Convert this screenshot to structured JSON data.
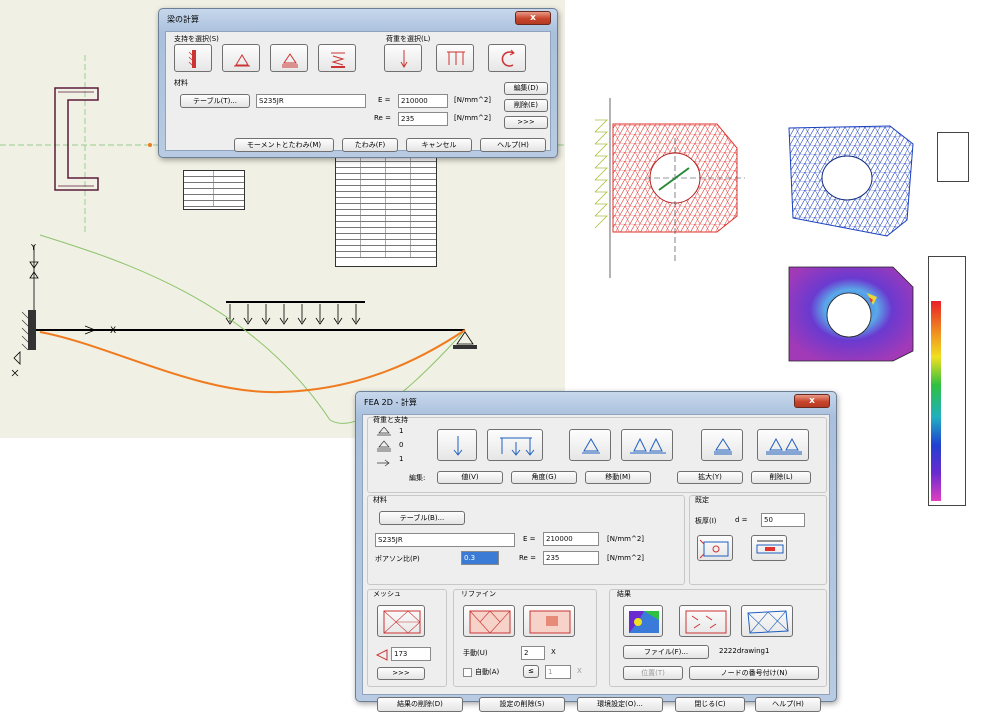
{
  "beam_dialog": {
    "title": "梁の計算",
    "close_label": "x",
    "support_label": "支持を選択(S)",
    "load_label": "荷重を選択(L)",
    "material_label": "材料",
    "table_button": "テーブル(T)...",
    "material_value": "S235JR",
    "e_label": "E =",
    "e_value": "210000",
    "e_unit": "[N/mm^2]",
    "re_label": "Re =",
    "re_value": "235",
    "re_unit": "[N/mm^2]",
    "edit_button": "編集(D)",
    "delete_button": "削除(E)",
    "more_button": ">>>",
    "moment_button": "モーメントとたわみ(M)",
    "deflection_button": "たわみ(F)",
    "cancel_button": "キャンセル",
    "help_button": "ヘルプ(H)"
  },
  "fea_dialog": {
    "title": "FEA 2D - 計算",
    "close_label": "x",
    "loads_supports_label": "荷重と支持",
    "counts": [
      "1",
      "0",
      "1"
    ],
    "edit_label": "編集:",
    "value_button": "値(V)",
    "angle_button": "角度(G)",
    "move_button": "移動(M)",
    "scale_button": "拡大(Y)",
    "delete_button": "削除(L)",
    "material_label": "材料",
    "table_button": "テーブル(B)...",
    "material_value": "S235JR",
    "poisson_label": "ポアソン比(P)",
    "poisson_value": "0.3",
    "e_label": "E =",
    "e_value": "210000",
    "e_unit": "[N/mm^2]",
    "re_label": "Re =",
    "re_value": "235",
    "re_unit": "[N/mm^2]",
    "settings_label": "既定",
    "thickness_label": "板厚(I)",
    "d_label": "d =",
    "thickness_value": "50",
    "mesh_label": "メッシュ",
    "mesh_value": "173",
    "mesh_more_button": ">>>",
    "refine_label": "リファイン",
    "manual_label": "手動(U)",
    "manual_value": "2",
    "times_symbol": "X",
    "auto_label": "自動(A)",
    "le_symbol": "≤",
    "auto_value": "1",
    "times_symbol_disabled": "X",
    "result_label": "結果",
    "file_button": "ファイル(F)...",
    "file_name": "2222drawing1",
    "position_button": "位置(T)",
    "node_number_button": "ノードの番号付け(N)",
    "delete_results_button": "結果の削除(D)",
    "delete_settings_button": "設定の削除(S)",
    "env_settings_button": "環境設定(O)...",
    "close_button": "閉じる(C)",
    "help_button": "ヘルプ(H)"
  },
  "colors": {
    "dialog_frame": "#a9c0dc",
    "close_red": "#c8452c",
    "cad_background": "#f0f0e4",
    "mesh_red": "#e0322c",
    "mesh_blue": "#1a3fbf",
    "deflection_orange": "#f07a1e",
    "moment_green": "#8cc46a"
  },
  "icons": {
    "support_buttons": [
      "fixed-support-icon",
      "pin-support-icon",
      "roller-support-icon",
      "spring-support-icon"
    ],
    "load_buttons": [
      "point-load-icon",
      "distributed-load-icon",
      "moment-load-icon"
    ],
    "fea_load_buttons": [
      "force-icon",
      "distributed-force-icon",
      "pin-icon",
      "pin-pair-icon",
      "roller-icon",
      "roller-pair-icon"
    ],
    "result_buttons": [
      "stress-color-map-icon",
      "vector-map-icon",
      "deformed-mesh-icon"
    ]
  }
}
